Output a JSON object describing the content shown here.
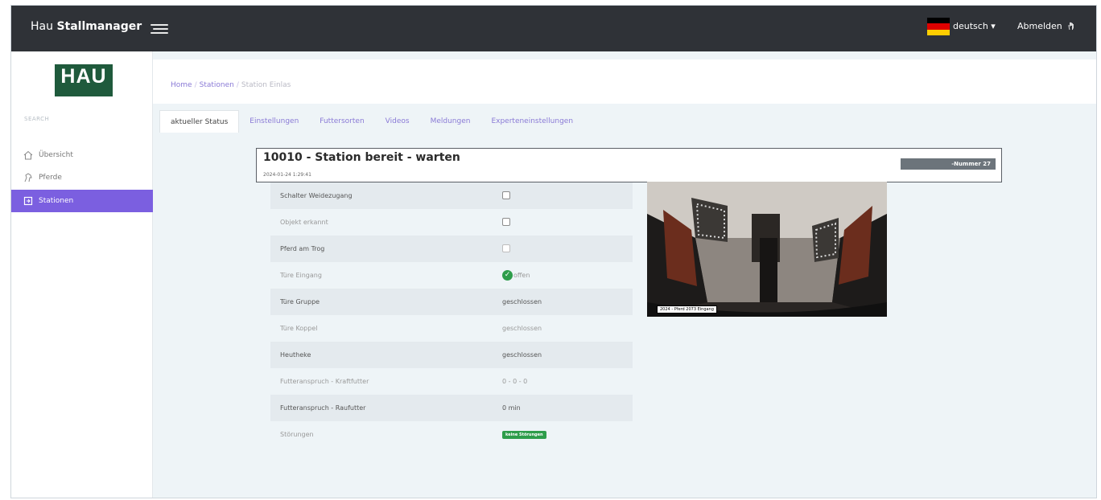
{
  "header": {
    "brand_light": "Hau ",
    "brand_bold": "Stallmanager",
    "language": "deutsch ▾",
    "logout": "Abmelden",
    "flag_colors": [
      "#000000",
      "#dd0000",
      "#ffce00"
    ]
  },
  "sidebar": {
    "logo_text": "HAU",
    "search_label": "SEARCH",
    "items": [
      {
        "label": "Übersicht",
        "icon": "home-icon"
      },
      {
        "label": "Pferde",
        "icon": "horse-icon"
      },
      {
        "label": "Stationen",
        "icon": "station-icon",
        "active": true
      }
    ]
  },
  "breadcrumb": {
    "home": "Home",
    "stations": "Stationen",
    "current": "Station Einlas"
  },
  "tabs": [
    {
      "label": "aktueller Status",
      "active": true
    },
    {
      "label": "Einstellungen"
    },
    {
      "label": "Futtersorten"
    },
    {
      "label": "Videos"
    },
    {
      "label": "Meldungen"
    },
    {
      "label": "Experteneinstellungen"
    }
  ],
  "status": {
    "title": "10010 - Station bereit - warten",
    "timestamp": "2024-01-24 1:29:41",
    "badge": "-Nummer 27"
  },
  "rows": [
    {
      "label": "Schalter Weidezugang",
      "type": "checkbox"
    },
    {
      "label": "Objekt erkannt",
      "type": "checkbox"
    },
    {
      "label": "Pferd am Trog",
      "type": "checkbox"
    },
    {
      "label": "Türe Eingang",
      "type": "ok",
      "value": "offen"
    },
    {
      "label": "Türe Gruppe",
      "type": "text",
      "value": "geschlossen"
    },
    {
      "label": "Türe Koppel",
      "type": "text",
      "value": "geschlossen"
    },
    {
      "label": "Heutheke",
      "type": "text",
      "value": "geschlossen"
    },
    {
      "label": "Futteranspruch - Kraftfutter",
      "type": "text",
      "value": "0 - 0 - 0"
    },
    {
      "label": "Futteranspruch - Raufutter",
      "type": "text",
      "value": "0 min"
    },
    {
      "label": "Störungen",
      "type": "badge",
      "value": "keine Störungen"
    }
  ],
  "camera": {
    "overlay": "2024 - Pferd 2073 Eingang"
  },
  "colors": {
    "accent": "#7b5fe0",
    "topbar": "#2f3237",
    "success": "#2e9d4b"
  }
}
